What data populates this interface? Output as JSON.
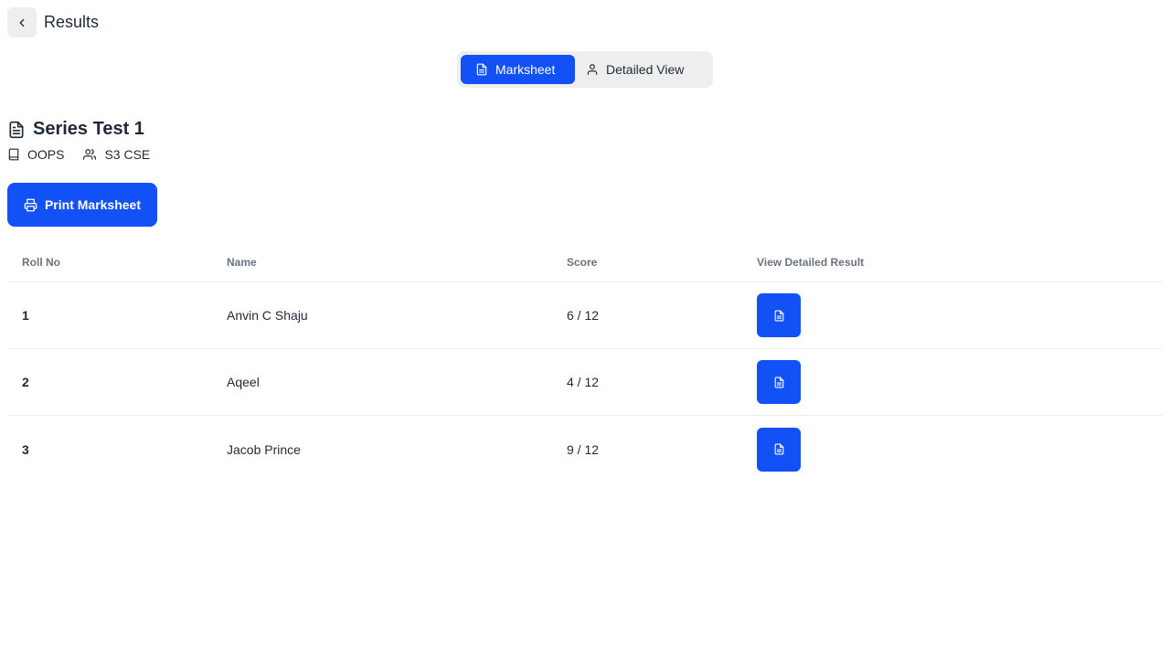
{
  "header": {
    "title": "Results",
    "back_icon": "chevron-left-icon"
  },
  "tabs": [
    {
      "label": "Marksheet",
      "icon": "document-icon",
      "active": true
    },
    {
      "label": "Detailed View",
      "icon": "user-icon",
      "active": false
    }
  ],
  "test": {
    "title": "Series Test 1",
    "subject": "OOPS",
    "class": "S3 CSE"
  },
  "print_button": {
    "label": "Print Marksheet",
    "icon": "printer-icon"
  },
  "table": {
    "headers": [
      "Roll No",
      "Name",
      "Score",
      "View Detailed Result"
    ],
    "rows": [
      {
        "roll": "1",
        "name": "Anvin C Shaju",
        "score": "6 / 12"
      },
      {
        "roll": "2",
        "name": "Aqeel",
        "score": "4 / 12"
      },
      {
        "roll": "3",
        "name": "Jacob Prince",
        "score": "9 / 12"
      }
    ]
  },
  "colors": {
    "accent": "#1251f5",
    "surface": "#eeeeee",
    "text": "#1f2937",
    "muted": "#6b7280"
  }
}
